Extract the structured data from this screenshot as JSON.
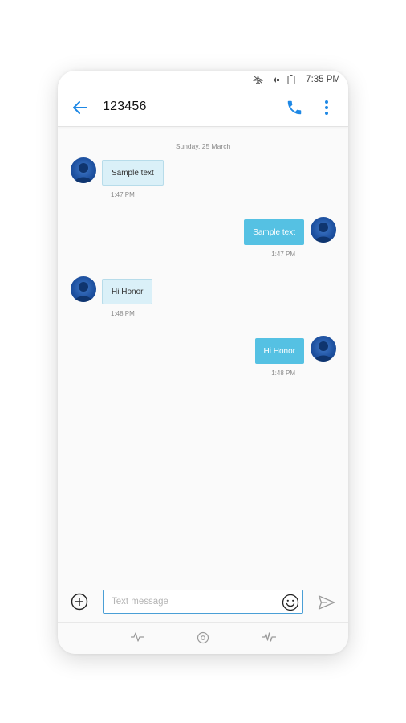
{
  "status_bar": {
    "time": "7:35 PM",
    "icons": [
      "airplane-off-icon",
      "signal-icon",
      "battery-icon"
    ]
  },
  "header": {
    "contact": "123456",
    "back_icon": "arrow-left-icon",
    "call_icon": "phone-icon",
    "menu_icon": "more-vertical-icon"
  },
  "thread": {
    "date": "Sunday, 25 March",
    "messages": [
      {
        "direction": "incoming",
        "text": "Sample text",
        "time": "1:47 PM"
      },
      {
        "direction": "outgoing",
        "text": "Sample text",
        "time": "1:47 PM"
      },
      {
        "direction": "incoming",
        "text": "Hi Honor",
        "time": "1:48 PM"
      },
      {
        "direction": "outgoing",
        "text": "Hi Honor",
        "time": "1:48 PM"
      }
    ]
  },
  "composer": {
    "placeholder": "Text message",
    "value": "",
    "add_icon": "add-circle-icon",
    "emoji_icon": "emoji-icon",
    "send_icon": "send-icon"
  },
  "nav_bar": {
    "icons": [
      "back-gesture-icon",
      "home-icon",
      "recents-gesture-icon"
    ]
  },
  "colors": {
    "accent": "#1e88e5",
    "incoming_bubble": "#daf0f8",
    "outgoing_bubble": "#55c1e3",
    "avatar": "#1c4f9e"
  }
}
